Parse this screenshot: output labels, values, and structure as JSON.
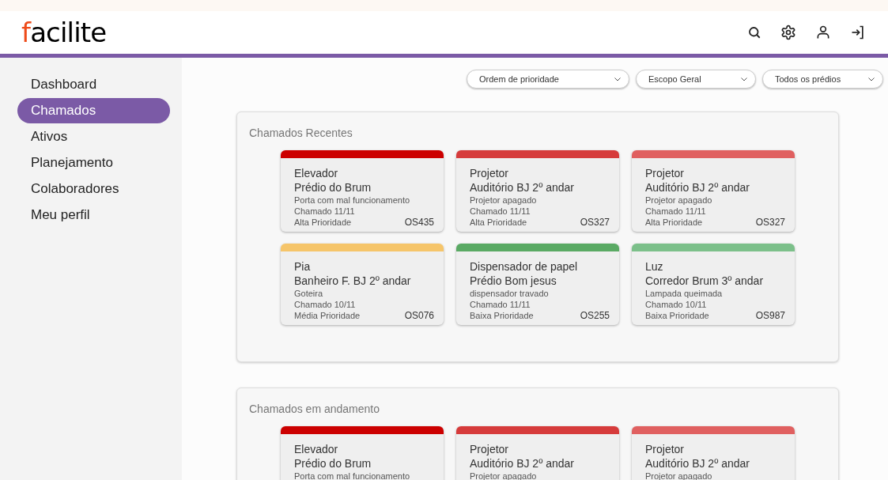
{
  "header": {
    "logo": "facilite"
  },
  "sidebar": {
    "items": [
      {
        "label": "Dashboard",
        "selected": false
      },
      {
        "label": "Chamados",
        "selected": true
      },
      {
        "label": "Ativos",
        "selected": false
      },
      {
        "label": "Planejamento",
        "selected": false
      },
      {
        "label": "Colaboradores",
        "selected": false
      },
      {
        "label": "Meu perfil",
        "selected": false
      }
    ]
  },
  "filters": [
    {
      "value": "Ordem de prioridade"
    },
    {
      "value": "Escopo Geral"
    },
    {
      "value": "Todos os prédios"
    }
  ],
  "sections": [
    {
      "title": "Chamados Recentes",
      "cards": [
        {
          "color": "#cc0000",
          "item": "Elevador",
          "location": "Prédio do Brum",
          "description": "Porta com mal funcionamento",
          "date": "Chamado 11/11",
          "priority": "Alta Prioridade",
          "code": "OS435"
        },
        {
          "color": "#d63b3b",
          "item": "Projetor",
          "location": "Auditório BJ 2º andar",
          "description": "Projetor apagado",
          "date": "Chamado 11/11",
          "priority": "Alta Prioridade",
          "code": "OS327"
        },
        {
          "color": "#e06060",
          "item": "Projetor",
          "location": "Auditório BJ 2º andar",
          "description": "Projetor apagado",
          "date": "Chamado 11/11",
          "priority": "Alta Prioridade",
          "code": "OS327"
        },
        {
          "color": "#f6c56a",
          "item": "Pia",
          "location": "Banheiro F. BJ 2º andar",
          "description": "Goteira",
          "date": "Chamado 10/11",
          "priority": "Média Prioridade",
          "code": "OS076"
        },
        {
          "color": "#5aaa64",
          "item": "Dispensador de papel",
          "location": "Prédio Bom jesus",
          "description": "dispensador travado",
          "date": "Chamado 11/11",
          "priority": "Baixa Prioridade",
          "code": "OS255"
        },
        {
          "color": "#7cc08a",
          "item": "Luz",
          "location": "Corredor Brum 3º andar",
          "description": "Lampada queimada",
          "date": "Chamado 10/11",
          "priority": "Baixa Prioridade",
          "code": "OS987"
        }
      ]
    },
    {
      "title": "Chamados em andamento",
      "cards": [
        {
          "color": "#cc0000",
          "item": "Elevador",
          "location": "Prédio do Brum",
          "description": "Porta com mal funcionamento"
        },
        {
          "color": "#d63b3b",
          "item": "Projetor",
          "location": "Auditório BJ 2º andar",
          "description": "Projetor apagado"
        },
        {
          "color": "#e06060",
          "item": "Projetor",
          "location": "Auditório BJ 2º andar",
          "description": "Projetor apagado"
        }
      ]
    }
  ]
}
